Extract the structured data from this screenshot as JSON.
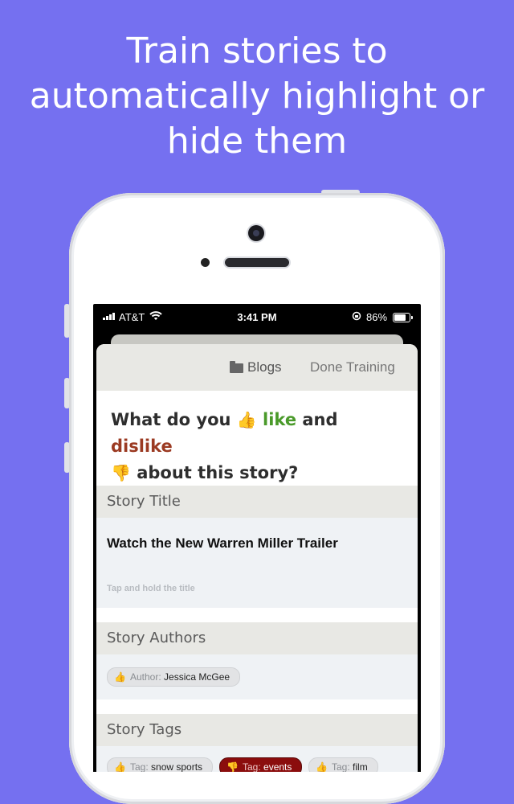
{
  "headline": {
    "line1": "Train stories to",
    "line2": "automatically highlight or",
    "line3": "hide them"
  },
  "status_bar": {
    "carrier": "AT&T",
    "time": "3:41 PM",
    "battery": "86%",
    "icons": [
      "signal-icon",
      "wifi-icon",
      "rotation-lock-icon",
      "battery-icon"
    ]
  },
  "toolbar": {
    "blogs_label": "Blogs",
    "done_label": "Done Training"
  },
  "question": {
    "part1": "What do you",
    "like_emoji": "👍",
    "like": "like",
    "and": "and",
    "dislike": "dislike",
    "dislike_emoji": "👎",
    "part2": "about this story?"
  },
  "sections": {
    "title": {
      "header": "Story Title",
      "value": "Watch the New Warren Miller Trailer",
      "hint": "Tap and hold the title"
    },
    "authors": {
      "header": "Story Authors",
      "chip": {
        "key": "Author:",
        "value": "Jessica McGee"
      }
    },
    "tags": {
      "header": "Story Tags",
      "chips": [
        {
          "key": "Tag:",
          "value": "snow sports",
          "state": "neutral"
        },
        {
          "key": "Tag:",
          "value": "events",
          "state": "disliked"
        },
        {
          "key": "Tag:",
          "value": "film",
          "state": "neutral"
        }
      ]
    }
  },
  "colors": {
    "background": "#7570f0",
    "like": "#4a9a2a",
    "dislike": "#9b3a22",
    "disliked_chip": "#8b0d0d"
  }
}
